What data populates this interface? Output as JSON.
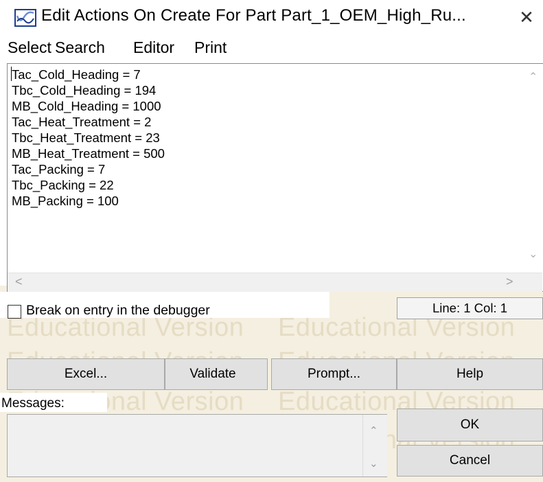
{
  "window": {
    "title": "Edit Actions On Create For Part Part_1_OEM_High_Ru...",
    "close_glyph": "✕",
    "icon": "app-logo-icon"
  },
  "menu": {
    "items": [
      {
        "label": "Select"
      },
      {
        "label": "Search"
      },
      {
        "label": "Editor"
      },
      {
        "label": "Print"
      }
    ]
  },
  "editor": {
    "lines": [
      "Tac_Cold_Heading = 7",
      "Tbc_Cold_Heading = 194",
      "MB_Cold_Heading = 1000",
      "Tac_Heat_Treatment = 2",
      "Tbc_Heat_Treatment = 23",
      "MB_Heat_Treatment = 500",
      "Tac_Packing = 7",
      "Tbc_Packing = 22",
      "MB_Packing = 100"
    ],
    "scroll_up_glyph": "⌃",
    "scroll_down_glyph": "⌄",
    "scroll_left_glyph": "<",
    "scroll_right_glyph": ">"
  },
  "debugger": {
    "label": "Break on entry in the debugger",
    "checked": false
  },
  "status": {
    "line_col": "Line: 1 Col: 1"
  },
  "watermark": {
    "text": "Educational Version"
  },
  "buttons": {
    "excel": "Excel...",
    "validate": "Validate",
    "prompt": "Prompt...",
    "help": "Help",
    "ok": "OK",
    "cancel": "Cancel"
  },
  "messages": {
    "label": "Messages:",
    "content": "",
    "scroll_up_glyph": "⌃",
    "scroll_down_glyph": "⌄"
  },
  "colors": {
    "watermark_bg": "#f4efe0",
    "button_face": "#e1e1e1",
    "logo_blue": "#1f3c8c"
  }
}
